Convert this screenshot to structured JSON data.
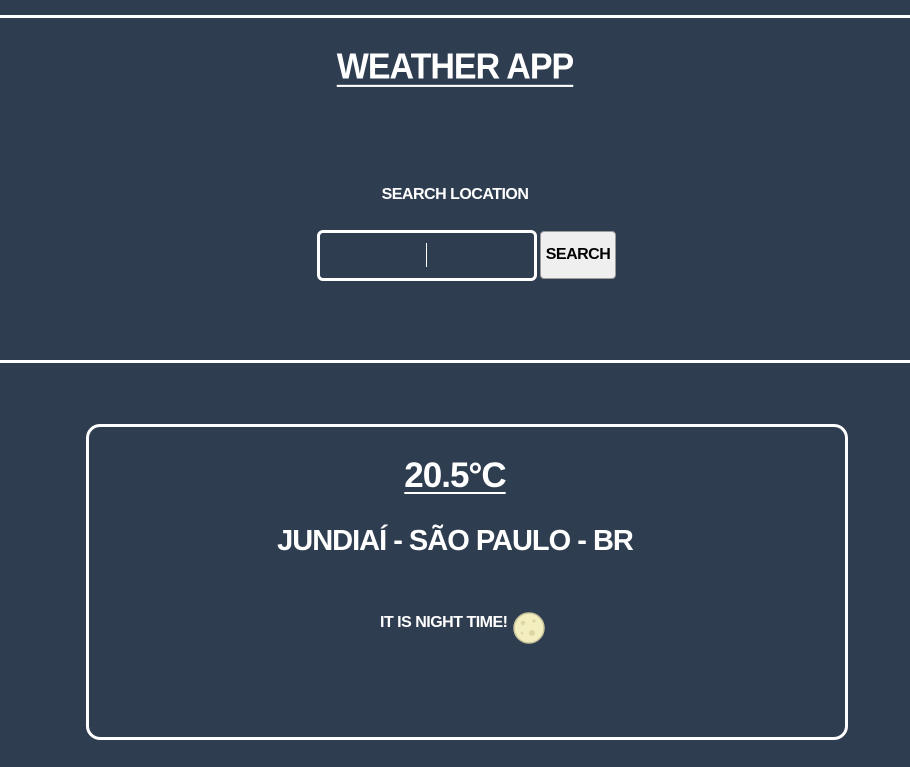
{
  "header": {
    "title": "WEATHER APP"
  },
  "search": {
    "label": "SEARCH LOCATION",
    "value": "",
    "placeholder": "",
    "button_label": "SEARCH"
  },
  "weather": {
    "temperature": "20.5°C",
    "location": "JUNDIAÍ - SÃO PAULO - BR",
    "time_of_day_text": "IT IS NIGHT TIME!",
    "time_of_day_icon": "moon-icon"
  },
  "colors": {
    "background": "#2e3d50",
    "foreground": "#ffffff",
    "button_background": "#efefef",
    "moon": "#f3eec0"
  }
}
